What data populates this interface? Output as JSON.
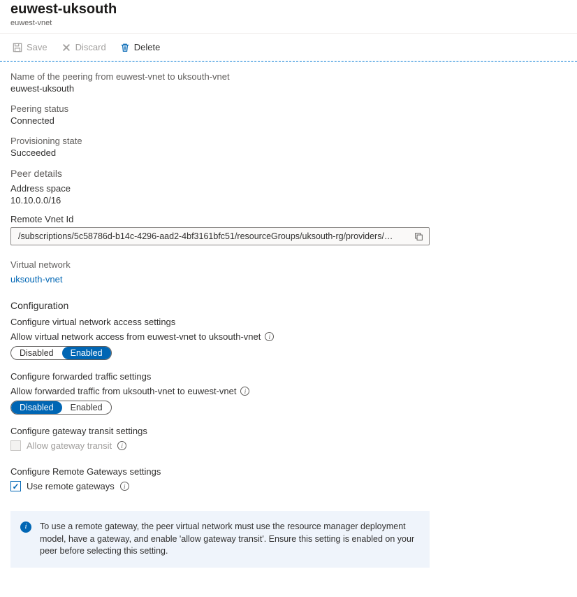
{
  "header": {
    "title": "euwest-uksouth",
    "subtitle": "euwest-vnet"
  },
  "toolbar": {
    "save": "Save",
    "discard": "Discard",
    "delete": "Delete"
  },
  "fields": {
    "name_label": "Name of the peering from euwest-vnet to uksouth-vnet",
    "name_value": "euwest-uksouth",
    "status_label": "Peering status",
    "status_value": "Connected",
    "prov_label": "Provisioning state",
    "prov_value": "Succeeded",
    "peer_details": "Peer details",
    "addr_label": "Address space",
    "addr_value": "10.10.0.0/16",
    "remote_id_label": "Remote Vnet Id",
    "remote_id_value": "/subscriptions/5c58786d-b14c-4296-aad2-4bf3161bfc51/resourceGroups/uksouth-rg/providers/…",
    "vnet_label": "Virtual network",
    "vnet_link": "uksouth-vnet"
  },
  "config": {
    "heading": "Configuration",
    "vna_sub": "Configure virtual network access settings",
    "vna_label": "Allow virtual network access from euwest-vnet to uksouth-vnet",
    "fwd_sub": "Configure forwarded traffic settings",
    "fwd_label": "Allow forwarded traffic from uksouth-vnet to euwest-vnet",
    "gw_sub": "Configure gateway transit settings",
    "gw_label": "Allow gateway transit",
    "rg_sub": "Configure Remote Gateways settings",
    "rg_label": "Use remote gateways",
    "toggle_disabled": "Disabled",
    "toggle_enabled": "Enabled"
  },
  "notice": {
    "text": "To use a remote gateway, the peer virtual network must use the resource manager deployment model, have a gateway, and enable 'allow gateway transit'. Ensure this setting is enabled on your peer before selecting this setting."
  }
}
